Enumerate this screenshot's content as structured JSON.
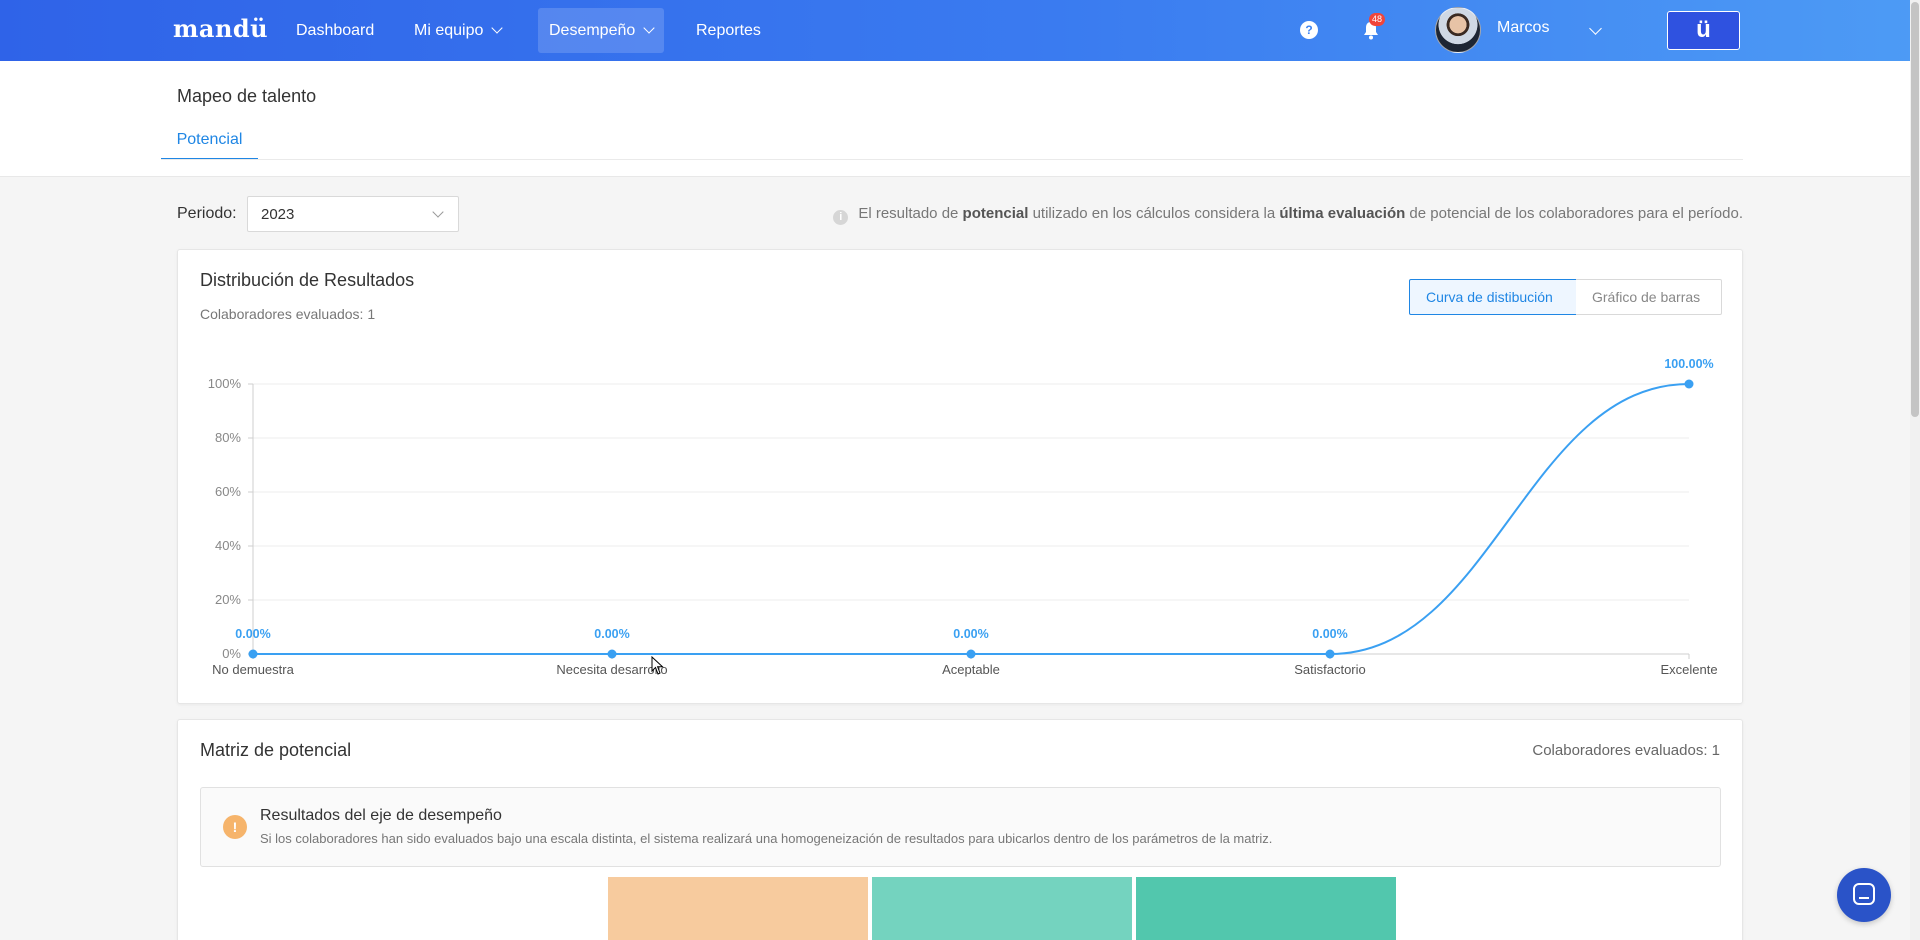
{
  "nav": {
    "logo": "mandü",
    "items": [
      {
        "label": "Dashboard"
      },
      {
        "label": "Mi equipo"
      },
      {
        "label": "Desempeño"
      },
      {
        "label": "Reportes"
      }
    ],
    "help": "?",
    "notifications_count": "48",
    "user_name": "Marcos",
    "brand_button": "ü"
  },
  "header": {
    "title": "Mapeo de talento",
    "tab": "Potencial"
  },
  "filters": {
    "periodo_label": "Periodo:",
    "periodo_value": "2023",
    "info_pre": "El resultado de ",
    "info_b1": "potencial",
    "info_mid": " utilizado en los cálculos considera la ",
    "info_b2": "última evaluación",
    "info_post": " de potencial de los colaboradores para el período."
  },
  "distribution": {
    "title": "Distribución de Resultados",
    "subtitle": "Colaboradores evaluados: 1",
    "toggle_curve": "Curva de distibución",
    "toggle_bars": "Gráfico de barras"
  },
  "chart_data": {
    "type": "line",
    "categories": [
      "No demuestra",
      "Necesita desarrollo",
      "Aceptable",
      "Satisfactorio",
      "Excelente"
    ],
    "values": [
      0,
      0,
      0,
      0,
      100
    ],
    "data_labels": [
      "0.00%",
      "0.00%",
      "0.00%",
      "0.00%",
      "100.00%"
    ],
    "yticks": [
      "0%",
      "20%",
      "40%",
      "60%",
      "80%",
      "100%"
    ],
    "ylim": [
      0,
      100
    ],
    "grid": true,
    "color": "#3aa0f2"
  },
  "matrix": {
    "title": "Matriz de potencial",
    "count": "Colaboradores evaluados: 1",
    "alert_icon": "!",
    "alert_title": "Resultados del eje de desempeño",
    "alert_text": "Si los colaboradores han sido evaluados bajo una escala distinta, el sistema realizará una homogeneización de resultados para ubicarlos dentro de los parámetros de la matriz.",
    "cell_colors": [
      "#f7cb9e",
      "#74d3bf",
      "#52c7ad"
    ]
  }
}
